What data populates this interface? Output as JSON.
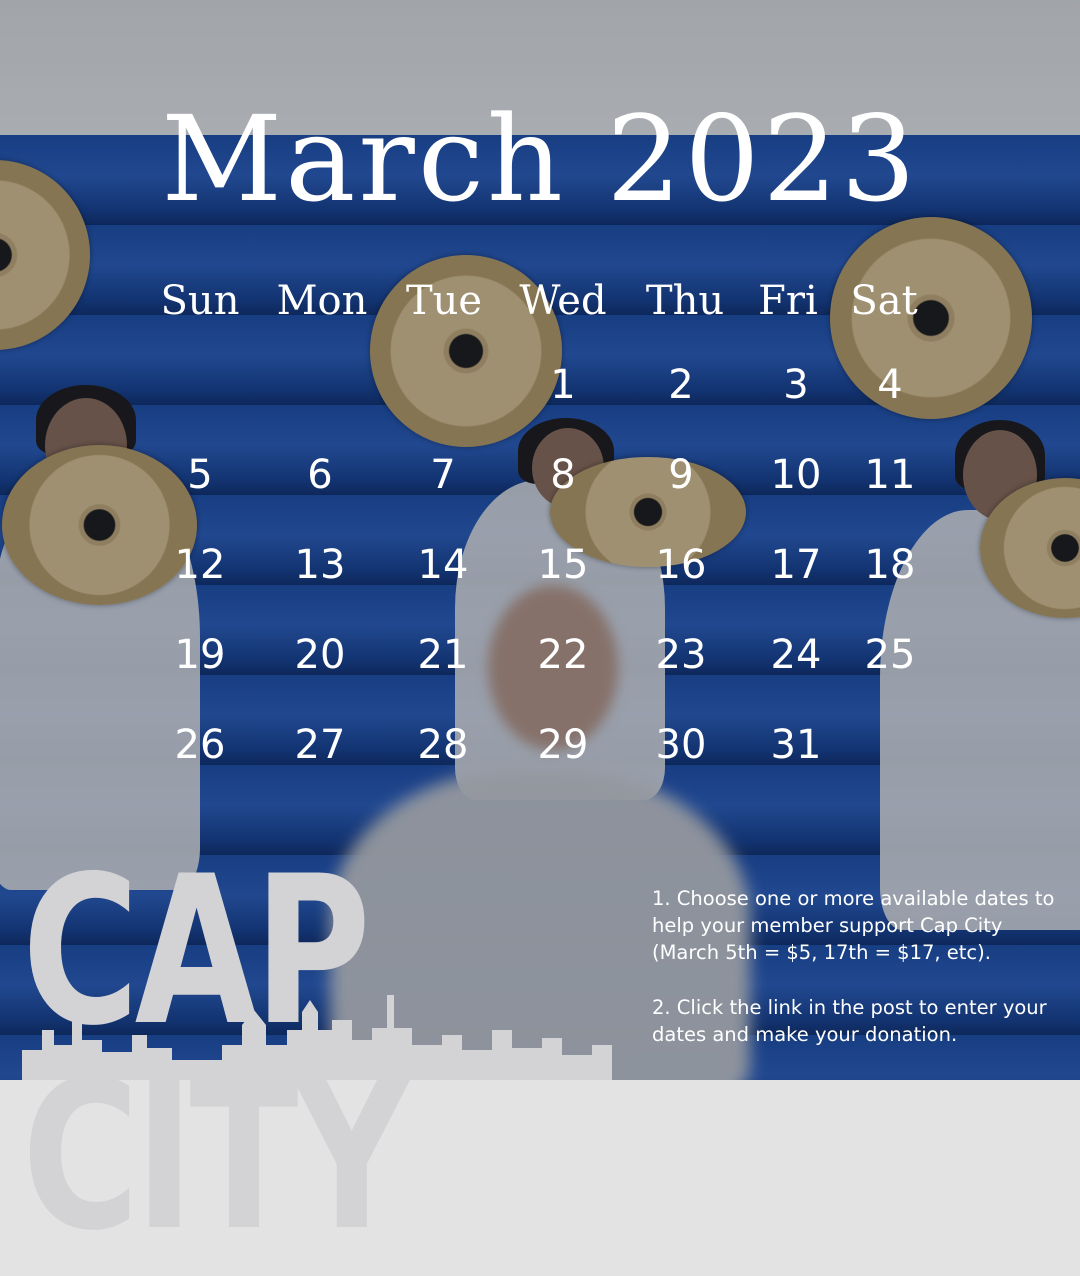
{
  "calendar": {
    "title": "March 2023",
    "weekdays": [
      "Sun",
      "Mon",
      "Tue",
      "Wed",
      "Thu",
      "Fri",
      "Sat"
    ],
    "first_weekday_index": 3,
    "days_in_month": 31
  },
  "logo": {
    "text": "CAP CITY"
  },
  "instructions": {
    "step1": "1. Choose one or more available dates to help your member support Cap City (March 5th = $5, 17th = $17, etc).",
    "step2": "2. Click the link in the post to enter your dates and make your donation."
  },
  "colors": {
    "bleacher_blue": "#1d4da6",
    "text": "#ffffff",
    "logo": "#d3d3d6",
    "cymbal_gold": "#d7c08e"
  }
}
